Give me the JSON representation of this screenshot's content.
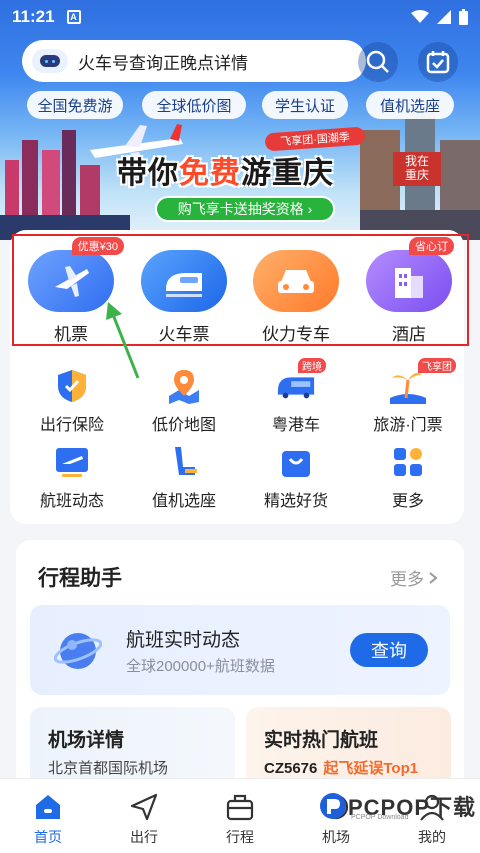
{
  "status_bar": {
    "time": "11:21",
    "notif_badge": "A"
  },
  "search": {
    "text": "火车号查询正晚点详情"
  },
  "quick_tags": [
    "全国免费游",
    "全球低价图",
    "学生认证",
    "值机选座"
  ],
  "banner": {
    "ribbon": "飞享团·国潮季",
    "title_pre": "带你",
    "title_hl": "免费",
    "title_post": "游重庆",
    "cta": "购飞享卡送抽奖资格 ›",
    "sign": "我在\n重庆"
  },
  "main_services": [
    {
      "label": "机票",
      "badge": "优惠¥30",
      "icon": "airplane-icon"
    },
    {
      "label": "火车票",
      "badge": "",
      "icon": "train-icon"
    },
    {
      "label": "伙力专车",
      "badge": "",
      "icon": "car-icon"
    },
    {
      "label": "酒店",
      "badge": "省心订",
      "icon": "hotel-icon"
    }
  ],
  "secondary_services": [
    {
      "label": "出行保险",
      "badge": "",
      "icon": "shield-icon"
    },
    {
      "label": "低价地图",
      "badge": "",
      "icon": "map-pin-icon"
    },
    {
      "label": "粤港车",
      "badge": "跨境",
      "icon": "bus-icon"
    },
    {
      "label": "旅游·门票",
      "badge": "飞享团",
      "icon": "palm-tree-icon"
    },
    {
      "label": "航班动态",
      "badge": "",
      "icon": "flight-status-icon"
    },
    {
      "label": "值机选座",
      "badge": "",
      "icon": "seat-icon"
    },
    {
      "label": "精选好货",
      "badge": "",
      "icon": "shopping-bag-icon"
    },
    {
      "label": "更多",
      "badge": "",
      "icon": "grid-icon"
    }
  ],
  "trip_assistant": {
    "title": "行程助手",
    "more": "更多",
    "flight_card": {
      "title": "航班实时动态",
      "subtitle": "全球200000+航班数据",
      "button": "查询"
    },
    "airport_card": {
      "title": "机场详情",
      "subtitle": "北京首都国际机场"
    },
    "hot_card": {
      "title": "实时热门航班",
      "flight": "CZ5676",
      "tag": "起飞延误Top1"
    }
  },
  "tabbar": [
    {
      "label": "首页",
      "icon": "home-icon",
      "active": true
    },
    {
      "label": "出行",
      "icon": "send-icon",
      "active": false
    },
    {
      "label": "行程",
      "icon": "suitcase-icon",
      "active": false
    },
    {
      "label": "机场",
      "icon": "airport-icon",
      "active": false
    },
    {
      "label": "我的",
      "icon": "user-icon",
      "active": false
    }
  ],
  "watermark": {
    "brand": "PCPOP下载",
    "sub": "PCPOP Download"
  },
  "colors": {
    "primary": "#1f6ae6",
    "badge": "#f24949",
    "highlight": "#e32626",
    "arrow": "#3bb34a"
  }
}
